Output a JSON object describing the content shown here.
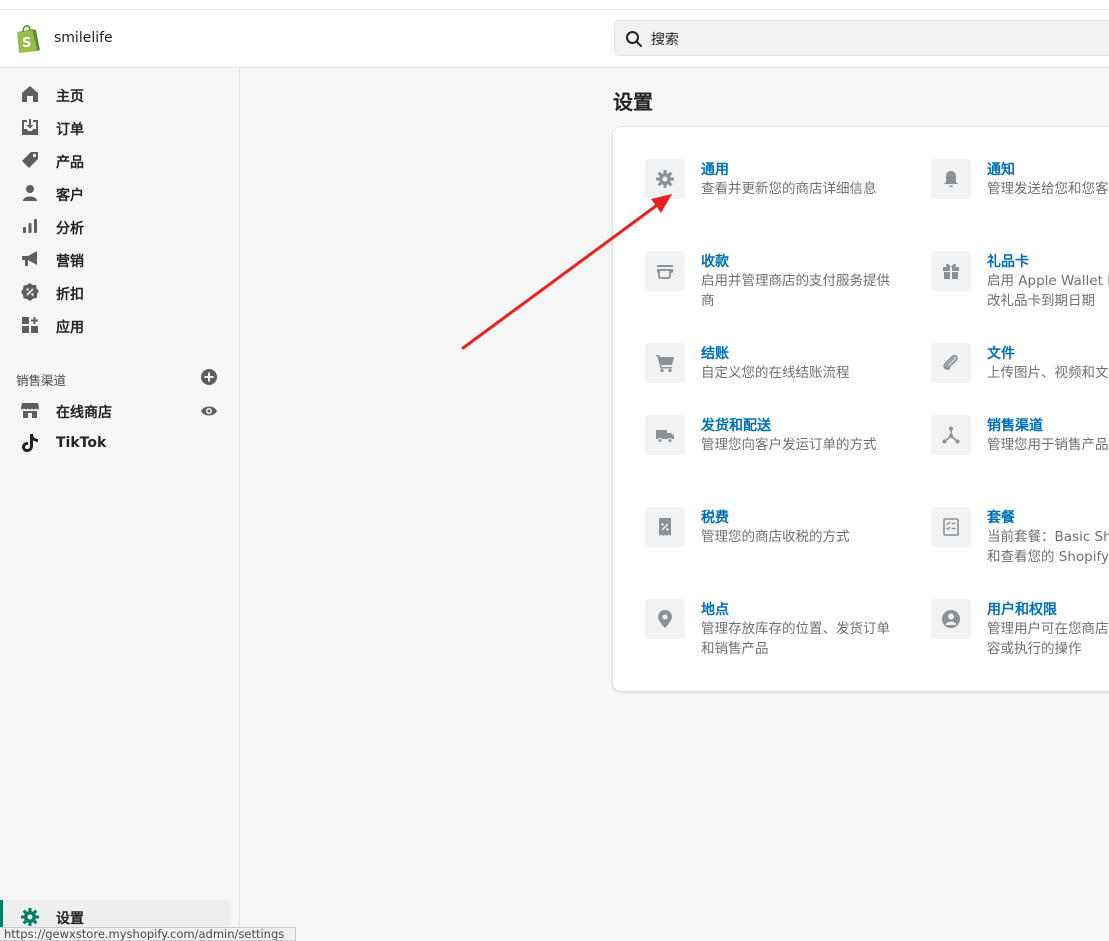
{
  "topbar": {
    "store_name": "smilelife",
    "search_placeholder": "搜索"
  },
  "sidebar": {
    "items": [
      {
        "label": "主页",
        "icon": "home-icon"
      },
      {
        "label": "订单",
        "icon": "orders-icon"
      },
      {
        "label": "产品",
        "icon": "tag-icon"
      },
      {
        "label": "客户",
        "icon": "customer-icon"
      },
      {
        "label": "分析",
        "icon": "analytics-icon"
      },
      {
        "label": "营销",
        "icon": "megaphone-icon"
      },
      {
        "label": "折扣",
        "icon": "discount-icon"
      },
      {
        "label": "应用",
        "icon": "apps-icon"
      }
    ],
    "sales_channels_heading": "销售渠道",
    "channels": [
      {
        "label": "在线商店",
        "icon": "store-icon"
      },
      {
        "label": "TikTok",
        "icon": "tiktok-icon"
      }
    ],
    "settings_label": "设置",
    "status_url": "https://gewxstore.myshopify.com/admin/settings"
  },
  "main": {
    "page_title": "设置",
    "settings": [
      {
        "title": "通用",
        "desc": "查看并更新您的商店详细信息",
        "icon": "gear-icon"
      },
      {
        "title": "通知",
        "desc": "管理发送给您和您客户的通知",
        "icon": "bell-icon"
      },
      {
        "title": "收款",
        "desc": "启用并管理商店的支付服务提供商",
        "icon": "payments-icon"
      },
      {
        "title": "礼品卡",
        "desc": "启用 Apple Wallet Passes 或更改礼品卡到期日期",
        "icon": "gift-icon"
      },
      {
        "title": "结账",
        "desc": "自定义您的在线结账流程",
        "icon": "cart-icon"
      },
      {
        "title": "文件",
        "desc": "上传图片、视频和文档",
        "icon": "paperclip-icon"
      },
      {
        "title": "发货和配送",
        "desc": "管理您向客户发运订单的方式",
        "icon": "truck-icon"
      },
      {
        "title": "销售渠道",
        "desc": "管理您用于销售产品的渠道",
        "icon": "channels-icon"
      },
      {
        "title": "税费",
        "desc": "管理您的商店收税的方式",
        "icon": "tax-icon"
      },
      {
        "title": "套餐",
        "desc": "当前套餐：Basic Shopify 管理和查看您的 Shopify 套餐",
        "icon": "plan-icon"
      },
      {
        "title": "地点",
        "desc": "管理存放库存的位置、发货订单和销售产品",
        "icon": "location-icon"
      },
      {
        "title": "用户和权限",
        "desc": "管理用户可在您商店中查看的内容或执行的操作",
        "icon": "user-icon"
      }
    ]
  },
  "colors": {
    "accent": "#008060",
    "link": "#006fbb",
    "annotation_arrow": "#e8231e"
  }
}
